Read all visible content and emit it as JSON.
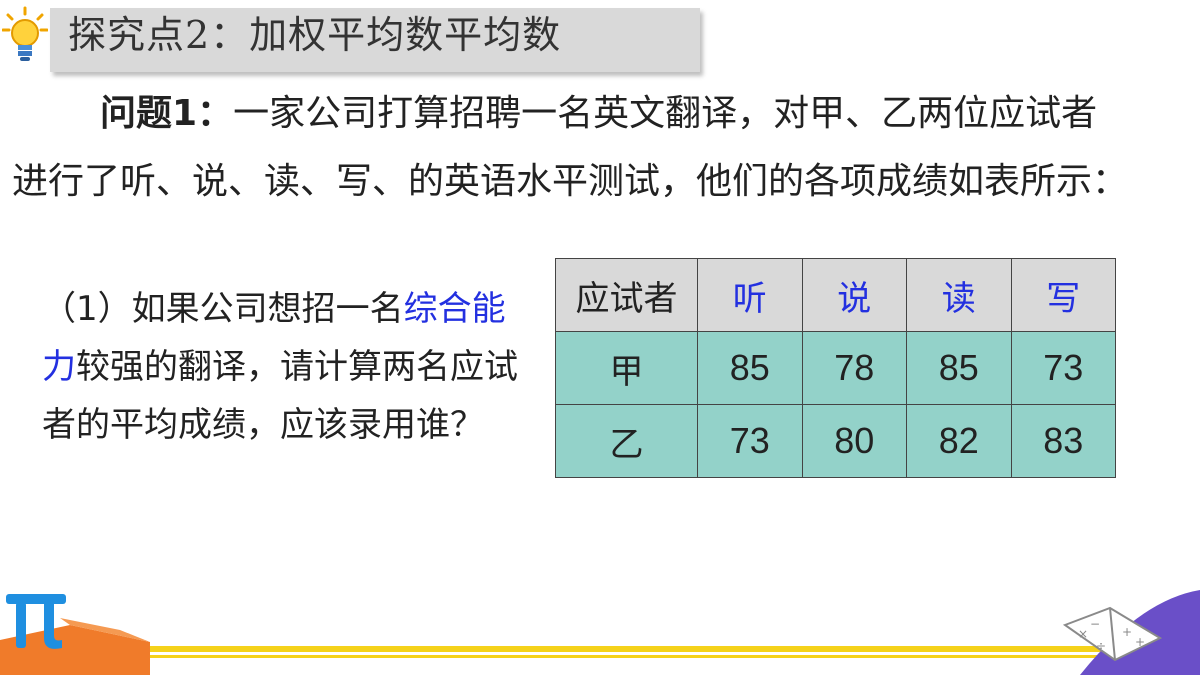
{
  "header": {
    "title": "探究点2：加权平均数平均数",
    "bulb_icon": "lightbulb-icon"
  },
  "intro": {
    "lead": "问题1：",
    "text": "一家公司打算招聘一名英文翻译，对甲、乙两位应试者进行了听、说、读、写、的英语水平测试，他们的各项成绩如表所示："
  },
  "question": {
    "part1": "（1）如果公司想招一名",
    "highlight": "综合能力",
    "part2": "较强的翻译，请计算两名应试者的平均成绩，应该录用谁？"
  },
  "table": {
    "headers": [
      "应试者",
      "听",
      "说",
      "读",
      "写"
    ],
    "rows": [
      {
        "name": "甲",
        "values": [
          "85",
          "78",
          "85",
          "73"
        ]
      },
      {
        "name": "乙",
        "values": [
          "73",
          "80",
          "82",
          "83"
        ]
      }
    ]
  },
  "colors": {
    "title_bg": "#d9d9d9",
    "table_header_bg": "#d9d9d9",
    "table_body_bg": "#93d2c9",
    "highlight": "#2330e0",
    "footer_stripe": "#f5d21a"
  },
  "decorations": [
    "pi-symbol-icon",
    "math-book-icon"
  ]
}
